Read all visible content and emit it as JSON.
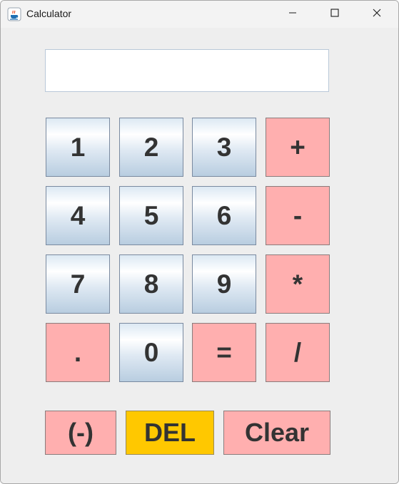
{
  "window": {
    "title": "Calculator",
    "minimize_icon": "minimize-icon",
    "maximize_icon": "maximize-icon",
    "close_icon": "close-icon",
    "app_icon": "java-cup-icon"
  },
  "display": {
    "value": ""
  },
  "keypad": {
    "k1": "1",
    "k2": "2",
    "k3": "3",
    "add": "+",
    "k4": "4",
    "k5": "5",
    "k6": "6",
    "sub": "-",
    "k7": "7",
    "k8": "8",
    "k9": "9",
    "mul": "*",
    "dot": ".",
    "k0": "0",
    "eq": "=",
    "div": "/"
  },
  "actions": {
    "negate": "(-)",
    "delete": "DEL",
    "clear": "Clear"
  },
  "colors": {
    "number_key": "#dfe9f3",
    "operator_key": "#ffafaf",
    "delete_key": "#ffc800",
    "background": "#eeeeee"
  }
}
